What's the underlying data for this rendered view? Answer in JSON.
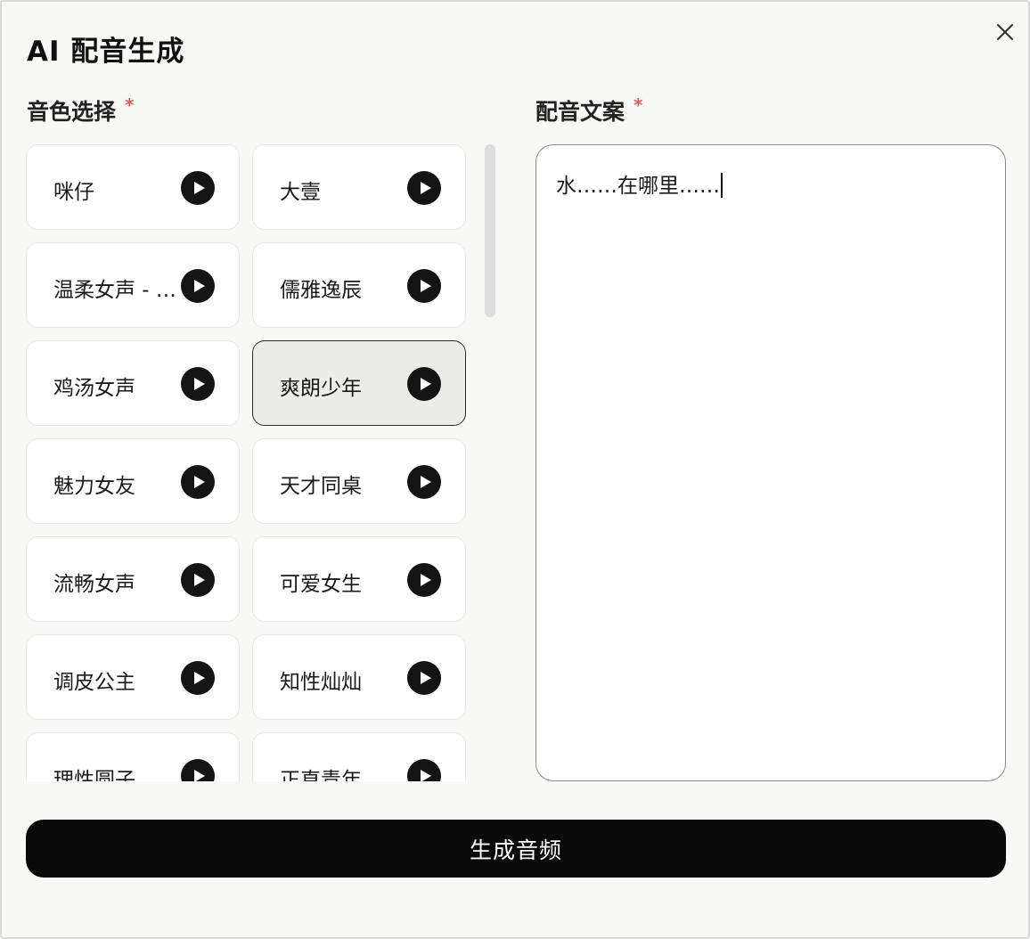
{
  "dialog": {
    "title": "AI 配音生成",
    "close_icon": "close-icon"
  },
  "voice_section": {
    "label": "音色选择",
    "required_mark": "*",
    "play_icon": "play-icon",
    "voices": [
      {
        "name": "咪仔",
        "selected": false
      },
      {
        "name": "大壹",
        "selected": false
      },
      {
        "name": "温柔女声 - …",
        "selected": false
      },
      {
        "name": "儒雅逸辰",
        "selected": false
      },
      {
        "name": "鸡汤女声",
        "selected": false
      },
      {
        "name": "爽朗少年",
        "selected": true
      },
      {
        "name": "魅力女友",
        "selected": false
      },
      {
        "name": "天才同桌",
        "selected": false
      },
      {
        "name": "流畅女声",
        "selected": false
      },
      {
        "name": "可爱女生",
        "selected": false
      },
      {
        "name": "调皮公主",
        "selected": false
      },
      {
        "name": "知性灿灿",
        "selected": false
      },
      {
        "name": "理性圆子",
        "selected": false
      },
      {
        "name": "正直青年",
        "selected": false
      }
    ]
  },
  "script_section": {
    "label": "配音文案",
    "required_mark": "*",
    "value": "水……在哪里……"
  },
  "generate_button": {
    "label": "生成音频"
  },
  "colors": {
    "accent": "#0a0a0a",
    "required": "#e05a5a",
    "selected_card_bg": "#ececeb",
    "background": "#f8f8f7"
  }
}
